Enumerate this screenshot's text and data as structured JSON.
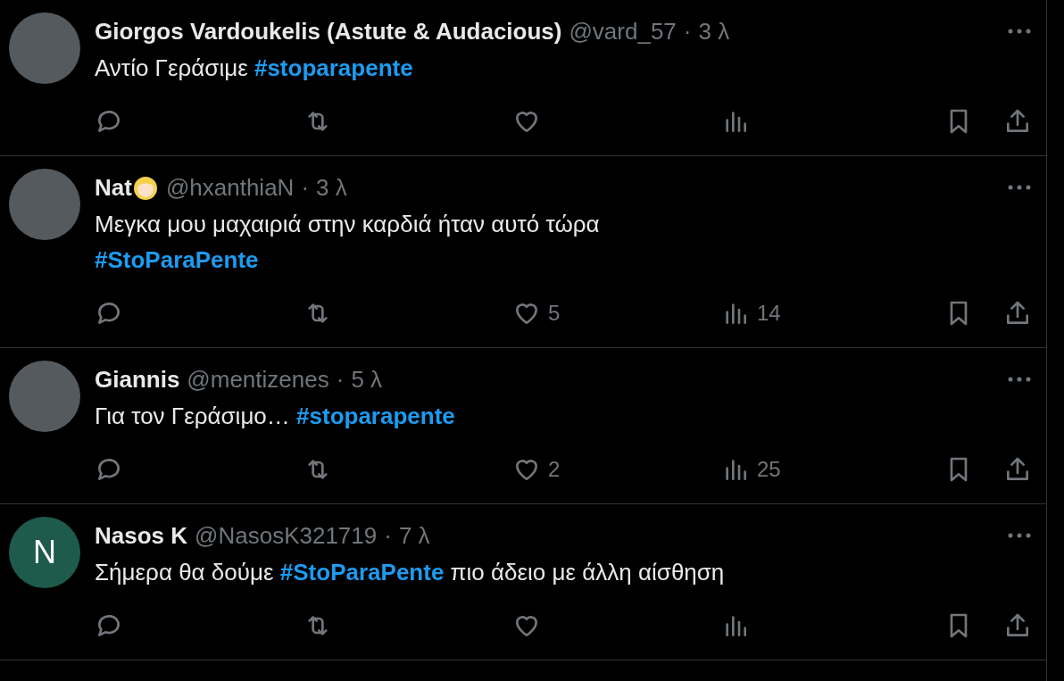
{
  "tweets": [
    {
      "avatar": {
        "kind": "photo"
      },
      "name": "Giorgos Vardoukelis (Astute & Audacious)",
      "emoji": false,
      "handle": "@vard_57",
      "separator": "·",
      "time": "3 λ",
      "text": [
        {
          "kind": "plain",
          "text": "Αντίο Γεράσιμε "
        },
        {
          "kind": "hashtag",
          "text": "#stoparapente"
        }
      ]
    },
    {
      "avatar": {
        "kind": "photo"
      },
      "name": "Nat",
      "emoji": true,
      "handle": "@hxanthiaN",
      "separator": "·",
      "time": "3 λ",
      "text": [
        {
          "kind": "plain",
          "text": "Μεγκα μου μαχαιριά στην καρδιά ήταν αυτό τώρα\n"
        },
        {
          "kind": "hashtag",
          "text": "#StoParaPente"
        }
      ],
      "likes": "5",
      "views": "14"
    },
    {
      "avatar": {
        "kind": "photo"
      },
      "name": "Giannis",
      "emoji": false,
      "handle": "@mentizenes",
      "separator": "·",
      "time": "5 λ",
      "text": [
        {
          "kind": "plain",
          "text": "Για τον Γεράσιμο… "
        },
        {
          "kind": "hashtag",
          "text": "#stoparapente"
        }
      ],
      "likes": "2",
      "views": "25"
    },
    {
      "avatar": {
        "kind": "letter",
        "letter": "N",
        "color": "#1e5b4c"
      },
      "name": "Nasos K",
      "emoji": false,
      "handle": "@NasosK321719",
      "separator": "·",
      "time": "7 λ",
      "text": [
        {
          "kind": "plain",
          "text": "Σήμερα θα δούμε "
        },
        {
          "kind": "hashtag",
          "text": "#StoParaPente"
        },
        {
          "kind": "plain",
          "text": " πιο άδειο με άλλη αίσθηση"
        }
      ]
    }
  ]
}
